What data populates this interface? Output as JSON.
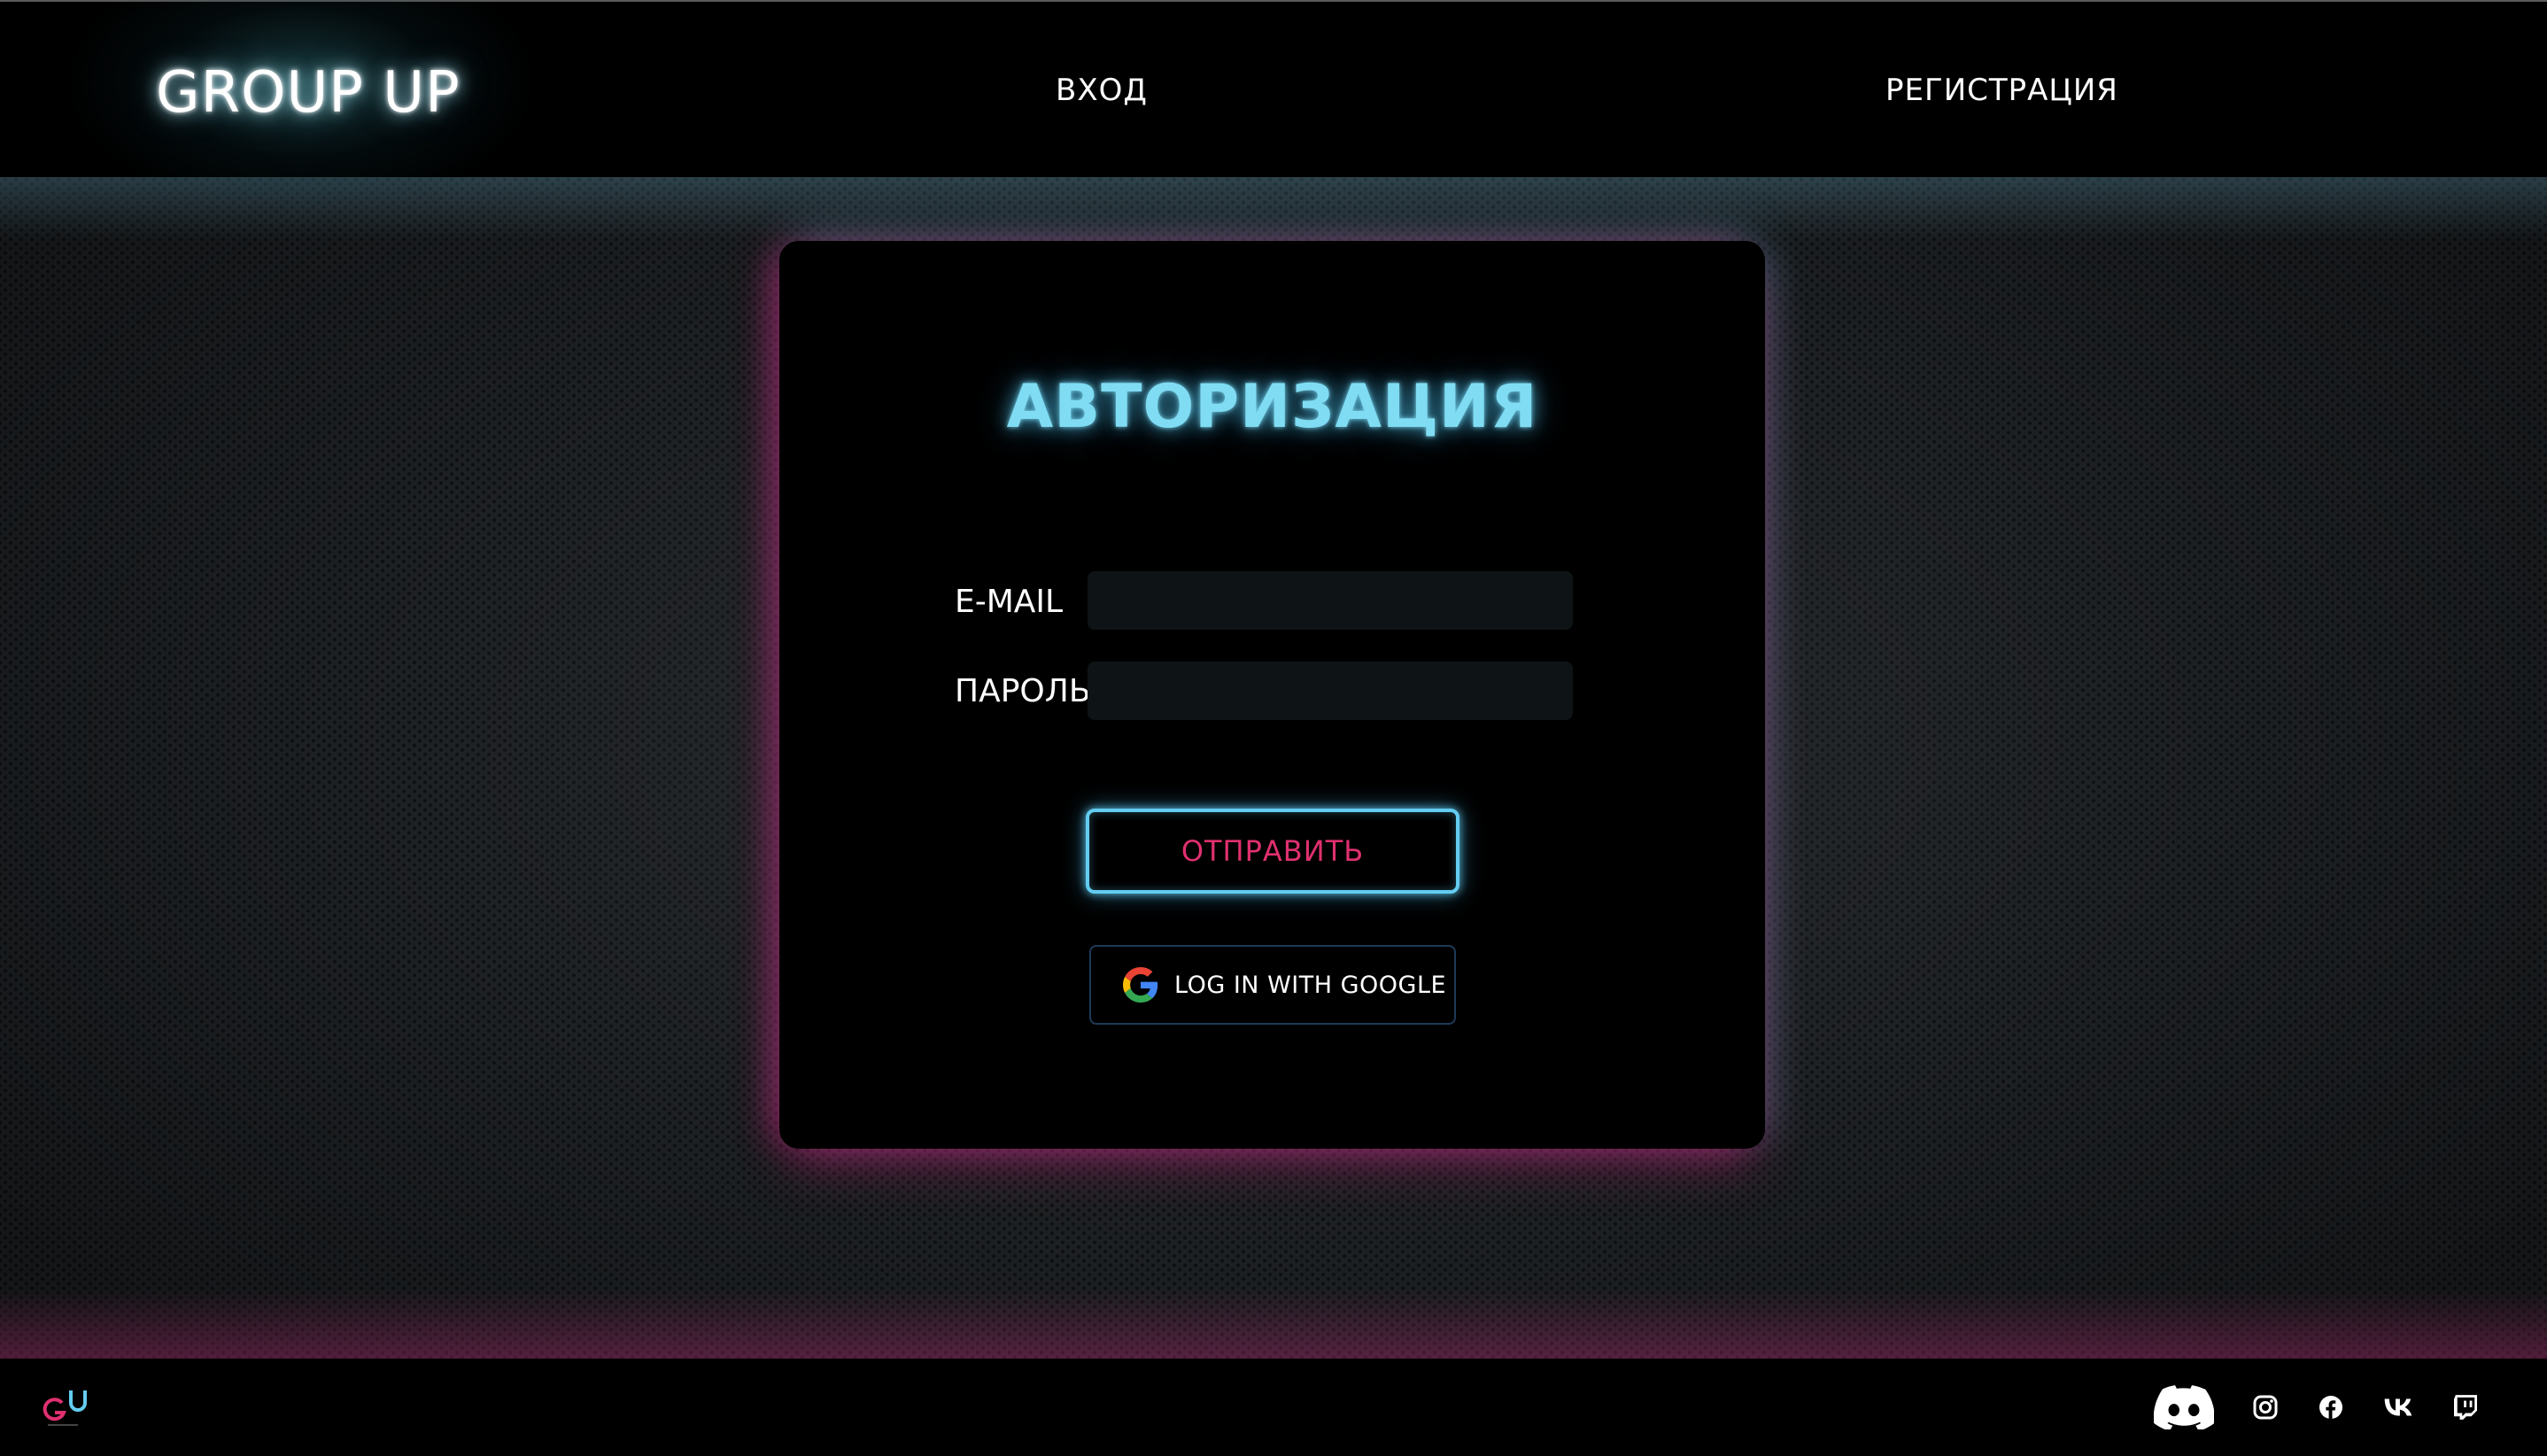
{
  "header": {
    "logo": "GROUP UP",
    "nav": {
      "login": "ВХОД",
      "register": "РЕГИСТРАЦИЯ"
    }
  },
  "auth_card": {
    "title": "АВТОРИЗАЦИЯ",
    "email_label": "E-MAIL",
    "email_value": "",
    "password_label": "ПАРОЛЬ",
    "password_value": "",
    "submit_label": "ОТПРАВИТЬ",
    "google_label": "LOG IN WITH GOOGLE"
  },
  "footer": {
    "logo_icon": "gu-logo-icon",
    "social": [
      "discord-icon",
      "instagram-icon",
      "facebook-icon",
      "vk-icon",
      "twitch-icon"
    ]
  },
  "colors": {
    "title": "#7fdcf3",
    "submit_text": "#e0306f",
    "submit_border": "#63ccf0",
    "card_background": "#000000",
    "page_background": "#1e2124"
  }
}
